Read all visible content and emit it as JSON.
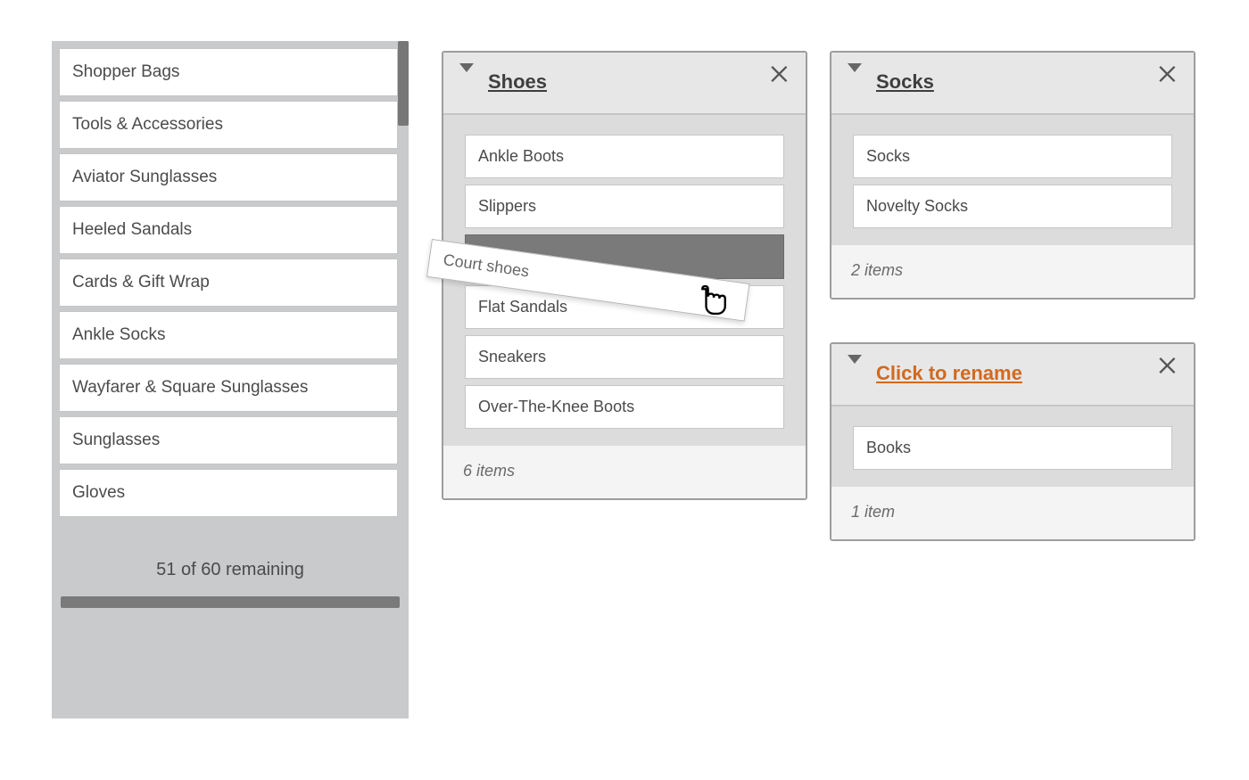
{
  "source": {
    "items": [
      "Shopper Bags",
      "Tools & Accessories",
      "Aviator Sunglasses",
      "Heeled Sandals",
      "Cards & Gift Wrap",
      "Ankle Socks",
      "Wayfarer & Square Sunglasses",
      "Sunglasses",
      "Gloves"
    ],
    "remaining_text": "51 of 60 remaining"
  },
  "dragging_label": "Court shoes",
  "cards": {
    "shoes": {
      "title": "Shoes",
      "items": [
        "Ankle Boots",
        "Slippers",
        "Flat Sandals",
        "Sneakers",
        "Over-The-Knee Boots"
      ],
      "count_text": "6 items"
    },
    "socks": {
      "title": "Socks",
      "items": [
        "Socks",
        "Novelty Socks"
      ],
      "count_text": "2 items"
    },
    "unnamed": {
      "title": "Click to rename",
      "items": [
        "Books"
      ],
      "count_text": "1 item"
    }
  },
  "colors": {
    "placeholder_title": "#d2691e"
  }
}
